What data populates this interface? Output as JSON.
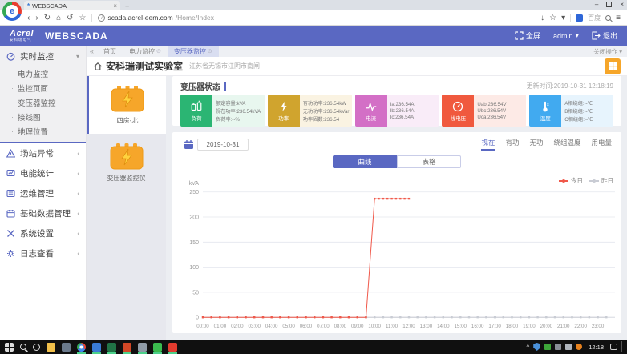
{
  "icons": {
    "back": "‹",
    "forward": "›",
    "refresh": "↻",
    "home": "⌂",
    "undo": "↺",
    "star": "☆",
    "dropdown": "▾",
    "menu": "≡",
    "minimize": "–",
    "close": "×",
    "new_tab": "+",
    "collapse": "«",
    "tab_action": "⊙",
    "chevron_collapsed": "‹",
    "chevron_expanded": "▾",
    "bullet": "·",
    "info": "i",
    "download": "↓",
    "tray_expand": "^",
    "favicon": "*"
  },
  "browser": {
    "tab_title": "WEBSCADA",
    "url_domain": "scada.acrel-eem.com",
    "url_path": "/Home/Index",
    "search_label": "百度"
  },
  "header": {
    "logo": "Acrel",
    "logo_sub": "安科瑞电气",
    "product": "WEBSCADA",
    "fullscreen": "全屏",
    "user": "admin",
    "logout": "退出"
  },
  "apptabs": {
    "items": [
      {
        "label": "首页"
      },
      {
        "label": "电力监控"
      },
      {
        "label": "变压器监控"
      }
    ],
    "close_ops": "关闭操作"
  },
  "sidebar": {
    "realtime": {
      "label": "实时监控",
      "children": [
        {
          "label": "电力监控"
        },
        {
          "label": "监控页面"
        },
        {
          "label": "变压器监控"
        },
        {
          "label": "接线图"
        },
        {
          "label": "地理位置"
        }
      ]
    },
    "items": [
      {
        "label": "场站异常"
      },
      {
        "label": "电能统计"
      },
      {
        "label": "运维管理"
      },
      {
        "label": "基础数据管理"
      },
      {
        "label": "系统设置"
      },
      {
        "label": "日志查看"
      }
    ]
  },
  "page": {
    "title": "安科瑞测试实验室",
    "subtitle": "江苏省无锡市江阴市南闸",
    "section": "变压器状态",
    "update_time": "更新时间:2019-10-31 12:18:19"
  },
  "devices": {
    "items": [
      {
        "label": "四房-北",
        "selected": true
      },
      {
        "label": "变压器监控仪",
        "selected": false
      }
    ]
  },
  "cards": {
    "items": [
      {
        "label": "负荷",
        "color": "#2bb573",
        "rows": [
          "额定容量:kVA",
          "视在功率:236.54kVA",
          "负荷率:--%"
        ]
      },
      {
        "label": "功率",
        "color": "#d0a42e",
        "rows": [
          "有功功率:236.54kW",
          "无功功率:236.54kVar",
          "功率因数:236.54"
        ]
      },
      {
        "label": "电流",
        "color": "#d36fc6",
        "rows": [
          "Ia:236.54A",
          "Ib:236.54A",
          "Ic:236.54A"
        ]
      },
      {
        "label": "线电压",
        "color": "#f0593e",
        "rows": [
          "Uab:236.54V",
          "Ubc:236.54V",
          "Uca:236.54V"
        ]
      },
      {
        "label": "温度",
        "color": "#41aaf0",
        "rows": [
          "A相绕组:--℃",
          "B相绕组:--℃",
          "C相绕组:--℃"
        ]
      }
    ]
  },
  "chart_panel": {
    "date": "2019-10-31",
    "tabs": [
      {
        "label": "视在"
      },
      {
        "label": "有功"
      },
      {
        "label": "无功"
      },
      {
        "label": "绕组温度"
      },
      {
        "label": "用电量"
      }
    ],
    "active_tab": "视在",
    "toggle": {
      "curve": "曲线",
      "table": "表格"
    },
    "active_view": "曲线",
    "legend": [
      {
        "label": "今日",
        "color": "#f0584a"
      },
      {
        "label": "昨日",
        "color": "#c9ccd4"
      }
    ]
  },
  "chart_data": {
    "type": "line",
    "title": "",
    "ylabel": "kVA",
    "ylim": [
      0,
      250
    ],
    "yticks": [
      0,
      50,
      100,
      150,
      200,
      250
    ],
    "x_range_hours": [
      0,
      24
    ],
    "xtick_labels": [
      "00:00",
      "01:00",
      "02:00",
      "03:00",
      "04:00",
      "05:00",
      "06:00",
      "07:00",
      "08:00",
      "09:00",
      "10:00",
      "11:00",
      "12:00",
      "13:00",
      "14:00",
      "15:00",
      "16:00",
      "17:00",
      "18:00",
      "19:00",
      "20:00",
      "21:00",
      "22:00",
      "23:00"
    ],
    "grid": true,
    "legend_position": "top-right",
    "series": [
      {
        "name": "今日",
        "color": "#f0584a",
        "segments": [
          {
            "start": 0,
            "end": 9.5,
            "step": 0.5,
            "value": 0
          },
          {
            "start": 10,
            "end": 12,
            "step": 0.25,
            "value": 236.54
          }
        ]
      },
      {
        "name": "昨日",
        "color": "#c9ccd4",
        "segments": [
          {
            "start": 0,
            "end": 23.5,
            "step": 0.5,
            "value": 0
          }
        ]
      }
    ]
  },
  "taskbar": {
    "time": "12:18",
    "icons": [
      {
        "name": "start",
        "shape": "win"
      },
      {
        "name": "search",
        "shape": "search"
      },
      {
        "name": "cortana",
        "shape": "circle"
      },
      {
        "name": "file-explorer",
        "color": "#f2c04a"
      },
      {
        "name": "monitor-app",
        "color": "#6b7a8c"
      },
      {
        "name": "chrome",
        "shape": "chrome",
        "underline": true
      },
      {
        "name": "app-blue",
        "color": "#3a7bd5",
        "underline": true
      },
      {
        "name": "excel",
        "color": "#217346",
        "underline": true
      },
      {
        "name": "powerpoint",
        "color": "#d24726",
        "underline": true
      },
      {
        "name": "app-media",
        "color": "#8f9aa6",
        "underline": true
      },
      {
        "name": "wechat",
        "color": "#3bbb4e",
        "underline": true
      },
      {
        "name": "app-red",
        "color": "#e23b2e",
        "underline": true
      }
    ]
  }
}
